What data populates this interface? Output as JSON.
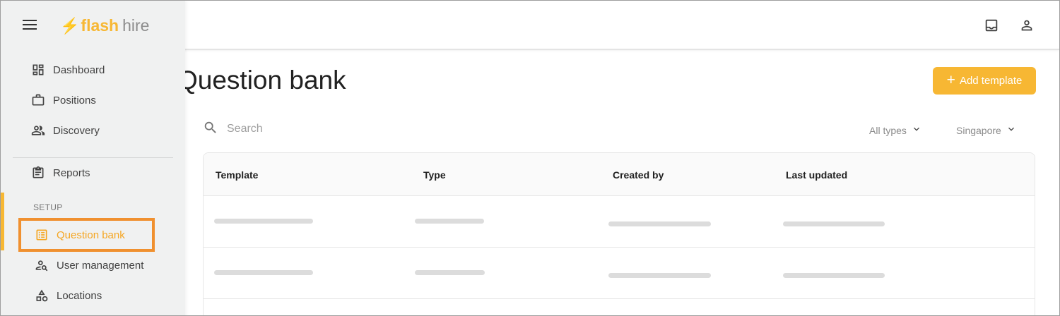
{
  "app": {
    "logo_flash": "flash",
    "logo_hire": "hire"
  },
  "header": {
    "inbox_icon": "inbox-icon",
    "account_icon": "account-icon"
  },
  "sidebar": {
    "items": [
      {
        "label": "Dashboard",
        "icon": "dashboard-icon"
      },
      {
        "label": "Positions",
        "icon": "briefcase-icon"
      },
      {
        "label": "Discovery",
        "icon": "people-icon"
      },
      {
        "label": "Reports",
        "icon": "clipboard-icon"
      }
    ],
    "section_label": "SETUP",
    "setup_items": [
      {
        "label": "Question bank",
        "icon": "list-icon",
        "active": true
      },
      {
        "label": "User management",
        "icon": "user-settings-icon"
      },
      {
        "label": "Locations",
        "icon": "shapes-icon"
      }
    ]
  },
  "main": {
    "title": "Question bank",
    "add_button": {
      "label": "Add template",
      "icon": "plus-icon"
    },
    "search": {
      "placeholder": "Search",
      "value": ""
    },
    "filters": {
      "type": "All types",
      "location": "Singapore"
    },
    "table": {
      "columns": [
        "Template",
        "Type",
        "Created by",
        "Last updated"
      ]
    }
  },
  "colors": {
    "accent": "#f7b733",
    "highlight": "#f0902f",
    "sidebar_bg": "#f0f1f1"
  }
}
